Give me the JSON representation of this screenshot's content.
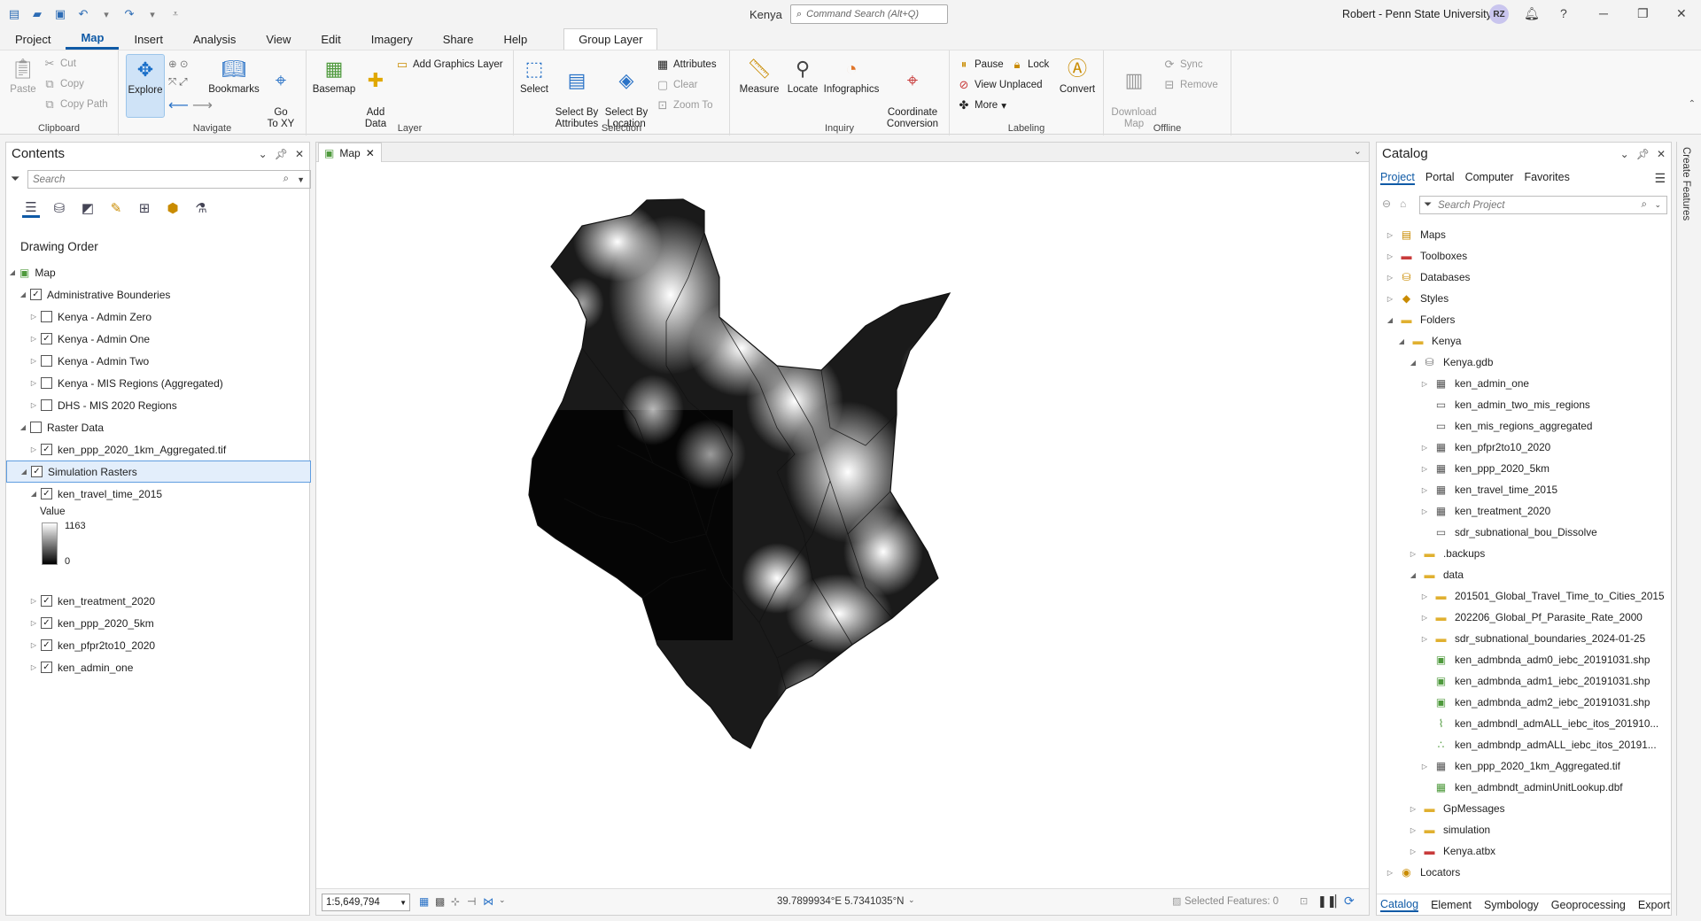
{
  "titlebar": {
    "app_title": "Kenya",
    "search_placeholder": "Command Search (Alt+Q)",
    "user": "Robert - Penn State University",
    "avatar": "RZ"
  },
  "ribbon_tabs": [
    "Project",
    "Map",
    "Insert",
    "Analysis",
    "View",
    "Edit",
    "Imagery",
    "Share",
    "Help"
  ],
  "context_tab": "Group Layer",
  "ribbon": {
    "clipboard": {
      "label": "Clipboard",
      "paste": "Paste",
      "cut": "Cut",
      "copy": "Copy",
      "copy_path": "Copy Path"
    },
    "navigate": {
      "label": "Navigate",
      "explore": "Explore",
      "bookmarks": "Bookmarks",
      "go_to_xy": "Go\nTo XY"
    },
    "layer": {
      "label": "Layer",
      "basemap": "Basemap",
      "add_data": "Add\nData",
      "add_graphics": "Add Graphics Layer"
    },
    "selection": {
      "label": "Selection",
      "select": "Select",
      "by_attributes": "Select By\nAttributes",
      "by_location": "Select By\nLocation",
      "attributes": "Attributes",
      "clear": "Clear",
      "zoom_to": "Zoom To"
    },
    "inquiry": {
      "label": "Inquiry",
      "measure": "Measure",
      "locate": "Locate",
      "infographics": "Infographics",
      "coord_conv": "Coordinate\nConversion"
    },
    "labeling": {
      "label": "Labeling",
      "pause": "Pause",
      "lock": "Lock",
      "view_unplaced": "View Unplaced",
      "more": "More",
      "convert": "Convert"
    },
    "offline": {
      "label": "Offline",
      "download_map": "Download\nMap",
      "sync": "Sync",
      "remove": "Remove"
    }
  },
  "contents": {
    "title": "Contents",
    "search_placeholder": "Search",
    "drawing_order": "Drawing Order",
    "map": "Map",
    "admin_group": "Administrative Bounderies",
    "admin_layers": [
      {
        "name": "Kenya - Admin Zero",
        "checked": false
      },
      {
        "name": "Kenya - Admin One",
        "checked": true
      },
      {
        "name": "Kenya - Admin Two",
        "checked": false
      },
      {
        "name": "Kenya - MIS Regions (Aggregated)",
        "checked": false
      },
      {
        "name": "DHS - MIS 2020 Regions",
        "checked": false
      }
    ],
    "raster_group": "Raster Data",
    "raster_layer": "ken_ppp_2020_1km_Aggregated.tif",
    "sim_group": "Simulation Rasters",
    "travel_time": "ken_travel_time_2015",
    "legend_title": "Value",
    "legend_max": "1163",
    "legend_min": "0",
    "sim_layers": [
      "ken_treatment_2020",
      "ken_ppp_2020_5km",
      "ken_pfpr2to10_2020",
      "ken_admin_one"
    ]
  },
  "map": {
    "tab": "Map",
    "scale": "1:5,649,794",
    "coords": "39.7899934°E 5.7341035°N",
    "selected_features": "Selected Features: 0"
  },
  "catalog": {
    "title": "Catalog",
    "tabs": [
      "Project",
      "Portal",
      "Computer",
      "Favorites"
    ],
    "search_placeholder": "Search Project",
    "items": [
      {
        "label": "Maps",
        "level": 0,
        "icon": "map-folder-icon",
        "exp": "▷"
      },
      {
        "label": "Toolboxes",
        "level": 0,
        "icon": "toolbox-icon",
        "exp": "▷"
      },
      {
        "label": "Databases",
        "level": 0,
        "icon": "database-icon",
        "exp": "▷"
      },
      {
        "label": "Styles",
        "level": 0,
        "icon": "styles-icon",
        "exp": "▷"
      },
      {
        "label": "Folders",
        "level": 0,
        "icon": "folder-icon",
        "exp": "◢"
      },
      {
        "label": "Kenya",
        "level": 1,
        "icon": "folder-icon",
        "exp": "◢"
      },
      {
        "label": "Kenya.gdb",
        "level": 2,
        "icon": "gdb-icon",
        "exp": "◢"
      },
      {
        "label": "ken_admin_one",
        "level": 3,
        "icon": "raster-icon",
        "exp": "▷"
      },
      {
        "label": "ken_admin_two_mis_regions",
        "level": 3,
        "icon": "polygon-fc-icon",
        "exp": ""
      },
      {
        "label": "ken_mis_regions_aggregated",
        "level": 3,
        "icon": "polygon-fc-icon",
        "exp": ""
      },
      {
        "label": "ken_pfpr2to10_2020",
        "level": 3,
        "icon": "raster-icon",
        "exp": "▷"
      },
      {
        "label": "ken_ppp_2020_5km",
        "level": 3,
        "icon": "raster-icon",
        "exp": "▷"
      },
      {
        "label": "ken_travel_time_2015",
        "level": 3,
        "icon": "raster-icon",
        "exp": "▷"
      },
      {
        "label": "ken_treatment_2020",
        "level": 3,
        "icon": "raster-icon",
        "exp": "▷"
      },
      {
        "label": "sdr_subnational_bou_Dissolve",
        "level": 3,
        "icon": "polygon-fc-icon",
        "exp": ""
      },
      {
        "label": ".backups",
        "level": 2,
        "icon": "folder-icon",
        "exp": "▷"
      },
      {
        "label": "data",
        "level": 2,
        "icon": "folder-icon",
        "exp": "◢"
      },
      {
        "label": "201501_Global_Travel_Time_to_Cities_2015",
        "level": 3,
        "icon": "folder-icon",
        "exp": "▷"
      },
      {
        "label": "202206_Global_Pf_Parasite_Rate_2000",
        "level": 3,
        "icon": "folder-icon",
        "exp": "▷"
      },
      {
        "label": "sdr_subnational_boundaries_2024-01-25",
        "level": 3,
        "icon": "folder-icon",
        "exp": "▷"
      },
      {
        "label": "ken_admbnda_adm0_iebc_20191031.shp",
        "level": 3,
        "icon": "shapefile-icon",
        "exp": ""
      },
      {
        "label": "ken_admbnda_adm1_iebc_20191031.shp",
        "level": 3,
        "icon": "shapefile-icon",
        "exp": ""
      },
      {
        "label": "ken_admbnda_adm2_iebc_20191031.shp",
        "level": 3,
        "icon": "shapefile-icon",
        "exp": ""
      },
      {
        "label": "ken_admbndl_admALL_iebc_itos_201910...",
        "level": 3,
        "icon": "line-shapefile-icon",
        "exp": ""
      },
      {
        "label": "ken_admbndp_admALL_iebc_itos_20191...",
        "level": 3,
        "icon": "point-shapefile-icon",
        "exp": ""
      },
      {
        "label": "ken_ppp_2020_1km_Aggregated.tif",
        "level": 3,
        "icon": "raster-icon",
        "exp": "▷"
      },
      {
        "label": "ken_admbndt_adminUnitLookup.dbf",
        "level": 3,
        "icon": "table-icon",
        "exp": ""
      },
      {
        "label": "GpMessages",
        "level": 2,
        "icon": "folder-icon",
        "exp": "▷"
      },
      {
        "label": "simulation",
        "level": 2,
        "icon": "folder-icon",
        "exp": "▷"
      },
      {
        "label": "Kenya.atbx",
        "level": 2,
        "icon": "toolbox-icon",
        "exp": "▷"
      },
      {
        "label": "Locators",
        "level": 0,
        "icon": "locator-icon",
        "exp": "▷"
      }
    ],
    "bottom_tabs": [
      "Catalog",
      "Element",
      "Symbology",
      "Geoprocessing",
      "Export"
    ]
  },
  "side_strip": "Create Features",
  "colors": {
    "accent": "#0f5aa6",
    "selected_bg": "#e3eefb"
  }
}
